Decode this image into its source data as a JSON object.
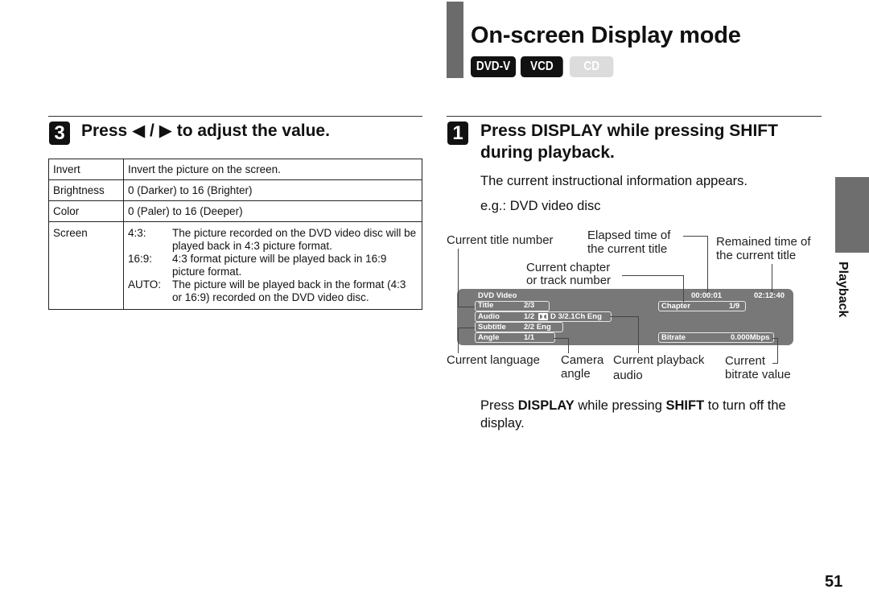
{
  "header": {
    "title": "On-screen Display mode",
    "badges": [
      {
        "label": "DVD-V",
        "active": true
      },
      {
        "label": "VCD",
        "active": true
      },
      {
        "label": "CD",
        "active": false
      }
    ]
  },
  "left_step": {
    "number": "3",
    "heading_pre": "Press ",
    "left_arrow": "◀",
    "separator": " / ",
    "right_arrow": "▶",
    "heading_post": " to adjust the value.",
    "table": [
      {
        "key": "Invert",
        "value": "Invert the picture on the screen."
      },
      {
        "key": "Brightness",
        "value": "0 (Darker) to 16 (Brighter)"
      },
      {
        "key": "Color",
        "value": "0 (Paler) to 16 (Deeper)"
      },
      {
        "key": "Screen",
        "options": [
          {
            "k": "4:3:",
            "v": "The picture recorded on the DVD video disc will be played back in 4:3 picture format."
          },
          {
            "k": "16:9:",
            "v": "4:3 format picture will be played back in 16:9 picture format."
          },
          {
            "k": "AUTO:",
            "v": "The picture will be played back in the format (4:3 or 16:9) recorded on the DVD video disc."
          }
        ]
      }
    ]
  },
  "right_step": {
    "number": "1",
    "heading": "Press DISPLAY while pressing SHIFT during playback.",
    "desc": "The current instructional information appears.",
    "example": "e.g.: DVD video disc",
    "callouts": {
      "title_number": "Current title number",
      "elapsed_1": "Elapsed time of",
      "elapsed_2": "the current title",
      "remained_1": "Remained time of",
      "remained_2": "the current title",
      "chapter_1": "Current chapter",
      "chapter_2": "or track number",
      "language": "Current language",
      "angle_1": "Camera",
      "angle_2": "angle",
      "audio_1": "Current playback",
      "audio_2": "audio",
      "bitrate_1": "Current",
      "bitrate_2": "bitrate value"
    },
    "osd": {
      "disc": "DVD Video",
      "elapsed": "00:00:01",
      "remaining": "02:12:40",
      "rows": [
        {
          "label": "Title",
          "value": "2/3"
        },
        {
          "label": "Audio",
          "value": "1/2",
          "icon": "dolby-digital-icon",
          "extra": "D 3/2.1Ch Eng"
        },
        {
          "label": "Subtitle",
          "value": "2/2 Eng"
        },
        {
          "label": "Angle",
          "value": "1/1"
        }
      ],
      "chapter_label": "Chapter",
      "chapter_value": "1/9",
      "bitrate_label": "Bitrate",
      "bitrate_value": "0.000Mbps"
    },
    "footer_pre": "Press ",
    "footer_b1": "DISPLAY",
    "footer_mid": " while pressing ",
    "footer_b2": "SHIFT",
    "footer_post": " to turn off the display."
  },
  "side_tab": "Playback",
  "page_number": "51"
}
